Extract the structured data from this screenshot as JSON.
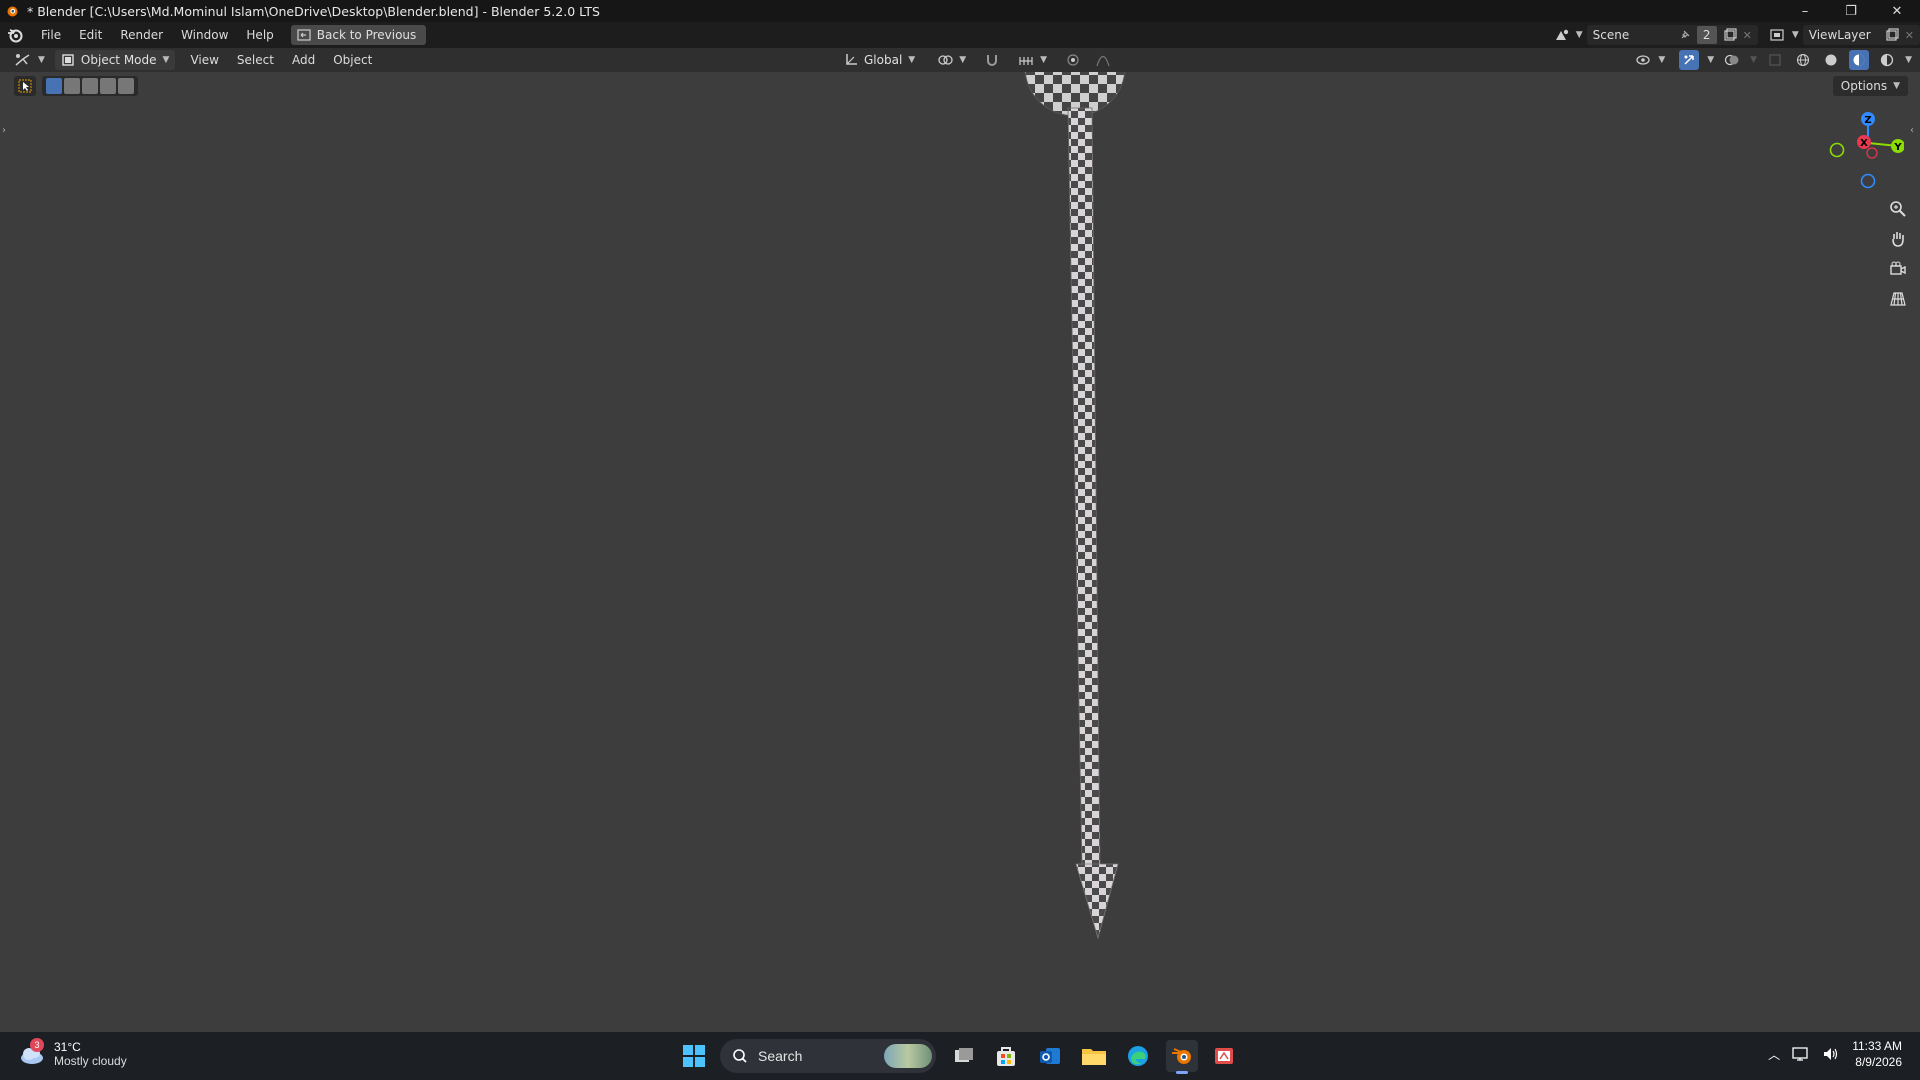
{
  "titlebar": {
    "title": "* Blender [C:\\Users\\Md.Mominul Islam\\OneDrive\\Desktop\\Blender.blend] - Blender 5.2.0 LTS",
    "minimize": "–",
    "maximize": "❐",
    "close": "✕"
  },
  "menubar": {
    "items": [
      "File",
      "Edit",
      "Render",
      "Window",
      "Help"
    ],
    "back_button": "Back to Previous",
    "scene": "Scene",
    "scene_users": "2",
    "view_layer": "ViewLayer"
  },
  "viewport_header": {
    "mode": "Object Mode",
    "menus": [
      "View",
      "Select",
      "Add",
      "Object"
    ],
    "transform_orientation": "Global",
    "options": "Options"
  },
  "gizmo": {
    "z_label": "Z",
    "x_label": "X",
    "y_label": "Y",
    "colors": {
      "x": "#e8384f",
      "y": "#8bdc00",
      "z": "#2f8bff"
    }
  },
  "taskbar": {
    "weather_temp": "31°C",
    "weather_desc": "Mostly cloudy",
    "weather_badge": "3",
    "search_placeholder": "Search",
    "time": "11:33 AM",
    "date": "8/9/2026"
  },
  "colors": {
    "viewport_bg": "#3d3d3d",
    "accent": "#4772b3",
    "blender_orange": "#ea7600"
  }
}
